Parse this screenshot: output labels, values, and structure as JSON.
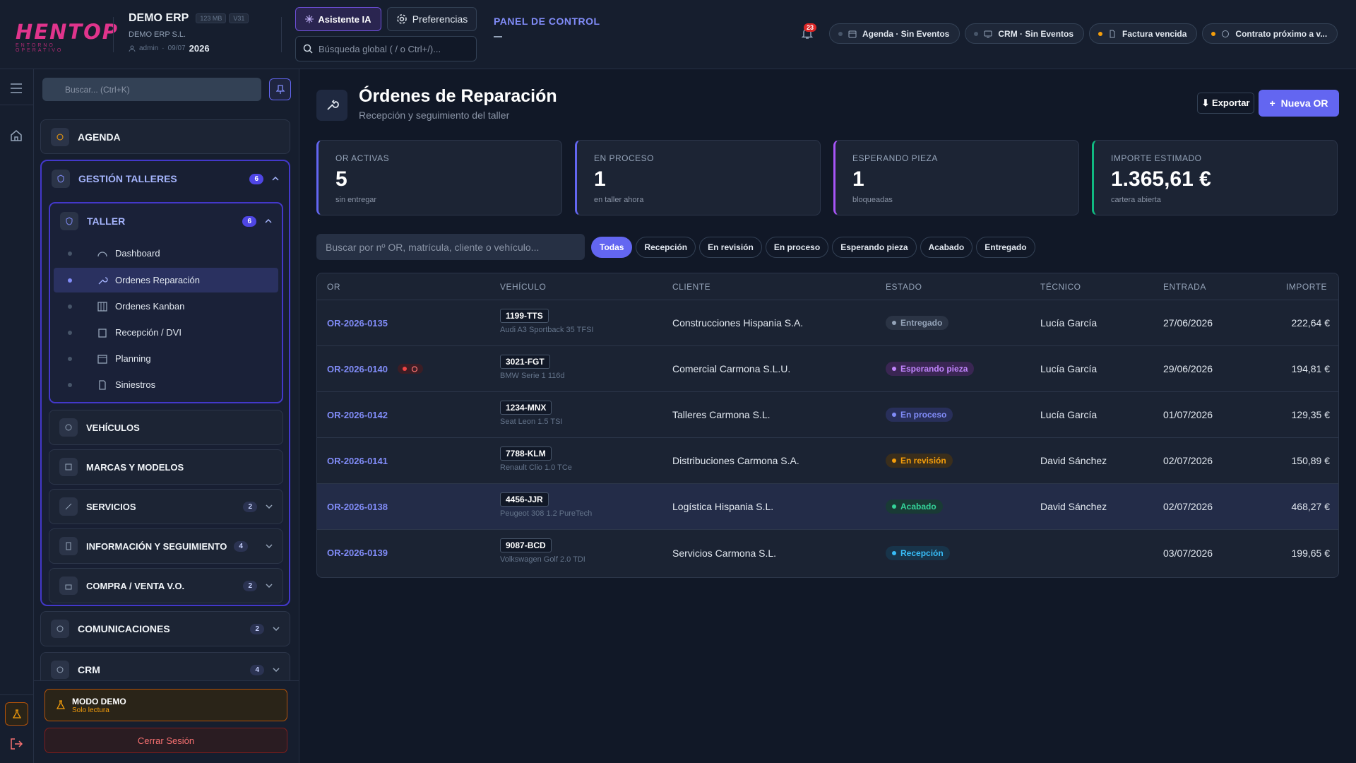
{
  "header": {
    "logo_text": "HENTOP",
    "logo_subtitle": "ENTORNO OPERATIVO",
    "app_name": "DEMO ERP",
    "size_chip": "123 MB",
    "version_chip": "V31",
    "company": "DEMO ERP S.L.",
    "user": "admin",
    "date": "09/07",
    "year": "2026",
    "ai_button": "Asistente IA",
    "pref_button": "Preferencias",
    "search_placeholder": "Búsqueda global ( / o Ctrl+/)...",
    "panel_label": "PANEL DE CONTROL",
    "panel_dash": "—",
    "notif_count": "23",
    "pills": [
      {
        "label": "Agenda · Sin Eventos",
        "dot_color": "#475569",
        "icon": "calendar-icon"
      },
      {
        "label": "CRM · Sin Eventos",
        "dot_color": "#475569",
        "icon": "monitor-icon"
      },
      {
        "label": "Factura vencida",
        "dot_color": "#f59e0b",
        "icon": "document-icon"
      },
      {
        "label": "Contrato próximo a v...",
        "dot_color": "#f59e0b",
        "icon": "clock-icon"
      }
    ]
  },
  "sidebar": {
    "search_placeholder": "Buscar... (Ctrl+K)",
    "agenda": "AGENDA",
    "gestion": {
      "label": "GESTIÓN TALLERES",
      "count": "6"
    },
    "taller": {
      "label": "TALLER",
      "count": "6"
    },
    "taller_items": [
      {
        "label": "Dashboard",
        "icon": "gauge-icon"
      },
      {
        "label": "Ordenes Reparación",
        "icon": "wrench-icon"
      },
      {
        "label": "Ordenes Kanban",
        "icon": "kanban-icon"
      },
      {
        "label": "Recepción / DVI",
        "icon": "clipboard-icon"
      },
      {
        "label": "Planning",
        "icon": "calendar-icon"
      },
      {
        "label": "Siniestros",
        "icon": "file-icon"
      }
    ],
    "vehiculos": "VEHÍCULOS",
    "marcas": "MARCAS Y MODELOS",
    "servicios": {
      "label": "SERVICIOS",
      "count": "2"
    },
    "informacion": {
      "label": "INFORMACIÓN Y SEGUIMIENTO",
      "count": "4"
    },
    "compra": {
      "label": "COMPRA / VENTA V.O.",
      "count": "2"
    },
    "comunicaciones": {
      "label": "COMUNICACIONES",
      "count": "2"
    },
    "crm": {
      "label": "CRM",
      "count": "4"
    },
    "demo_title": "MODO DEMO",
    "demo_sub": "Solo lectura",
    "logout": "Cerrar Sesión"
  },
  "page": {
    "title": "Órdenes de Reparación",
    "subtitle": "Recepción y seguimiento del taller",
    "export_button": "⬇ Exportar",
    "new_button": "Nueva OR",
    "new_icon": "+"
  },
  "kpis": [
    {
      "label": "OR ACTIVAS",
      "value": "5",
      "sub": "sin entregar",
      "color": "#6366f1"
    },
    {
      "label": "EN PROCESO",
      "value": "1",
      "sub": "en taller ahora",
      "color": "#6366f1"
    },
    {
      "label": "ESPERANDO PIEZA",
      "value": "1",
      "sub": "bloqueadas",
      "color": "#a855f7"
    },
    {
      "label": "IMPORTE ESTIMADO",
      "value": "1.365,61 €",
      "sub": "cartera abierta",
      "color": "#10b981"
    }
  ],
  "table_search_placeholder": "Buscar por nº OR, matrícula, cliente o vehículo...",
  "filters": [
    "Todas",
    "Recepción",
    "En revisión",
    "En proceso",
    "Esperando pieza",
    "Acabado",
    "Entregado"
  ],
  "columns": [
    "OR",
    "VEHÍCULO",
    "CLIENTE",
    "ESTADO",
    "TÉCNICO",
    "ENTRADA",
    "IMPORTE"
  ],
  "rows": [
    {
      "or": "OR-2026-0135",
      "plate": "1199-TTS",
      "model": "Audi A3 Sportback 35 TFSI",
      "client": "Construcciones Hispania S.A.",
      "status": "Entregado",
      "status_color": "#94a3b8",
      "status_bg": "#2b3445",
      "tech": "Lucía García",
      "date": "27/06/2026",
      "amount": "222,64 €",
      "alert": false
    },
    {
      "or": "OR-2026-0140",
      "plate": "3021-FGT",
      "model": "BMW Serie 1 116d",
      "client": "Comercial Carmona S.L.U.",
      "status": "Esperando pieza",
      "status_color": "#c084fc",
      "status_bg": "#3a2653",
      "tech": "Lucía García",
      "date": "29/06/2026",
      "amount": "194,81 €",
      "alert": true
    },
    {
      "or": "OR-2026-0142",
      "plate": "1234-MNX",
      "model": "Seat Leon 1.5 TSI",
      "client": "Talleres Carmona S.L.",
      "status": "En proceso",
      "status_color": "#818cf8",
      "status_bg": "#282f5a",
      "tech": "Lucía García",
      "date": "01/07/2026",
      "amount": "129,35 €",
      "alert": false
    },
    {
      "or": "OR-2026-0141",
      "plate": "7788-KLM",
      "model": "Renault Clio 1.0 TCe",
      "client": "Distribuciones Carmona S.A.",
      "status": "En revisión",
      "status_color": "#f59e0b",
      "status_bg": "#3a2e1c",
      "tech": "David Sánchez",
      "date": "02/07/2026",
      "amount": "150,89 €",
      "alert": false
    },
    {
      "or": "OR-2026-0138",
      "plate": "4456-JJR",
      "model": "Peugeot 308 1.2 PureTech",
      "client": "Logística Hispania S.L.",
      "status": "Acabado",
      "status_color": "#34d399",
      "status_bg": "#193a35",
      "tech": "David Sánchez",
      "date": "02/07/2026",
      "amount": "468,27 €",
      "alert": false
    },
    {
      "or": "OR-2026-0139",
      "plate": "9087-BCD",
      "model": "Volkswagen Golf 2.0 TDI",
      "client": "Servicios Carmona S.L.",
      "status": "Recepción",
      "status_color": "#38bdf8",
      "status_bg": "#18344a",
      "tech": "",
      "date": "03/07/2026",
      "amount": "199,65 €",
      "alert": false
    }
  ]
}
